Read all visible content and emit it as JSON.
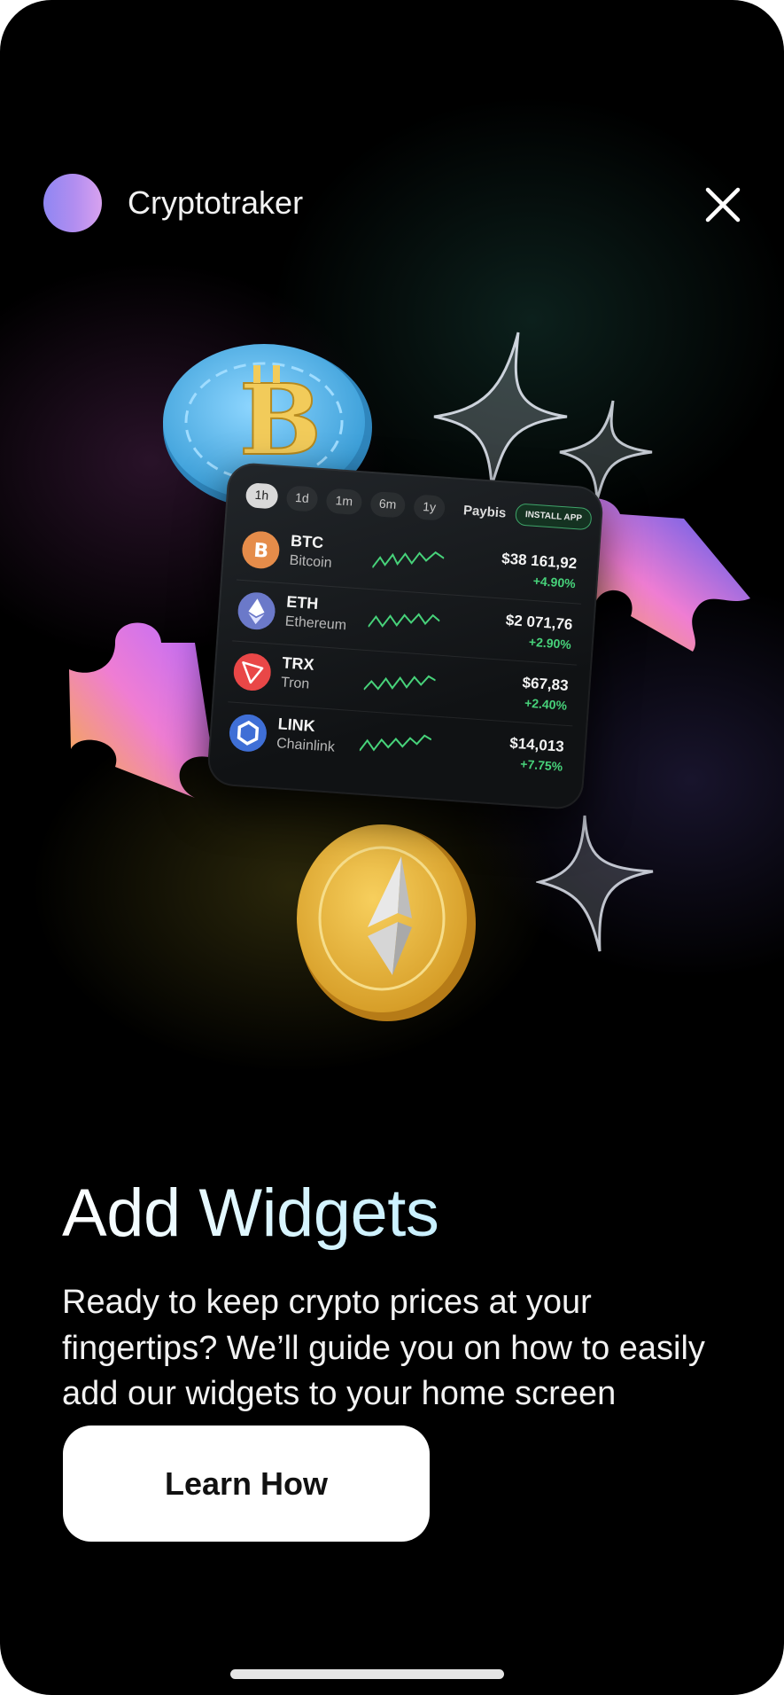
{
  "header": {
    "app_name": "Cryptotraker",
    "close_icon": "close-icon"
  },
  "widget": {
    "tabs": [
      "1h",
      "1d",
      "1m",
      "6m",
      "1y"
    ],
    "active_tab": "1h",
    "brand": "Paybis",
    "install_label": "INSTALL APP",
    "rows": [
      {
        "symbol": "BTC",
        "name": "Bitcoin",
        "price": "$38 161,92",
        "change": "+4.90%",
        "icon": "bitcoin-icon",
        "color": "#e58c4a"
      },
      {
        "symbol": "ETH",
        "name": "Ethereum",
        "price": "$2 071,76",
        "change": "+2.90%",
        "icon": "ethereum-icon",
        "color": "#6b79c9"
      },
      {
        "symbol": "TRX",
        "name": "Tron",
        "price": "$67,83",
        "change": "+2.40%",
        "icon": "tron-icon",
        "color": "#e94747"
      },
      {
        "symbol": "LINK",
        "name": "Chainlink",
        "price": "$14,013",
        "change": "+7.75%",
        "icon": "chainlink-icon",
        "color": "#3f6fd6"
      }
    ]
  },
  "content": {
    "title": "Add Widgets",
    "description": "Ready to keep crypto prices at your fingertips? We’ll guide you on how to easily add our widgets to your home screen",
    "cta_label": "Learn How"
  },
  "colors": {
    "background": "#000000",
    "accent_green": "#47d27a",
    "logo_gradient_start": "#8f86f2",
    "logo_gradient_end": "#d8a2ef"
  }
}
